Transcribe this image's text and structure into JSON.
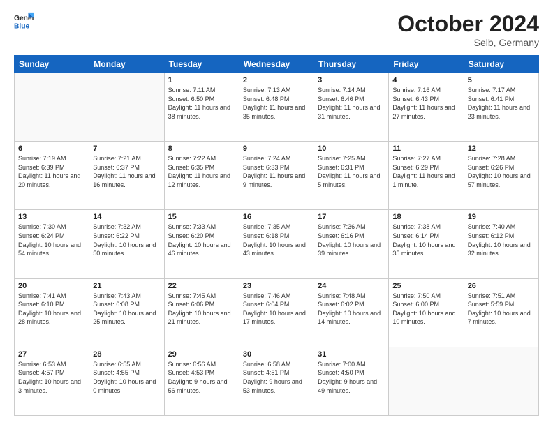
{
  "header": {
    "logo_general": "General",
    "logo_blue": "Blue",
    "month_title": "October 2024",
    "location": "Selb, Germany"
  },
  "weekdays": [
    "Sunday",
    "Monday",
    "Tuesday",
    "Wednesday",
    "Thursday",
    "Friday",
    "Saturday"
  ],
  "weeks": [
    [
      {
        "day": "",
        "info": ""
      },
      {
        "day": "",
        "info": ""
      },
      {
        "day": "1",
        "info": "Sunrise: 7:11 AM\nSunset: 6:50 PM\nDaylight: 11 hours and 38 minutes."
      },
      {
        "day": "2",
        "info": "Sunrise: 7:13 AM\nSunset: 6:48 PM\nDaylight: 11 hours and 35 minutes."
      },
      {
        "day": "3",
        "info": "Sunrise: 7:14 AM\nSunset: 6:46 PM\nDaylight: 11 hours and 31 minutes."
      },
      {
        "day": "4",
        "info": "Sunrise: 7:16 AM\nSunset: 6:43 PM\nDaylight: 11 hours and 27 minutes."
      },
      {
        "day": "5",
        "info": "Sunrise: 7:17 AM\nSunset: 6:41 PM\nDaylight: 11 hours and 23 minutes."
      }
    ],
    [
      {
        "day": "6",
        "info": "Sunrise: 7:19 AM\nSunset: 6:39 PM\nDaylight: 11 hours and 20 minutes."
      },
      {
        "day": "7",
        "info": "Sunrise: 7:21 AM\nSunset: 6:37 PM\nDaylight: 11 hours and 16 minutes."
      },
      {
        "day": "8",
        "info": "Sunrise: 7:22 AM\nSunset: 6:35 PM\nDaylight: 11 hours and 12 minutes."
      },
      {
        "day": "9",
        "info": "Sunrise: 7:24 AM\nSunset: 6:33 PM\nDaylight: 11 hours and 9 minutes."
      },
      {
        "day": "10",
        "info": "Sunrise: 7:25 AM\nSunset: 6:31 PM\nDaylight: 11 hours and 5 minutes."
      },
      {
        "day": "11",
        "info": "Sunrise: 7:27 AM\nSunset: 6:29 PM\nDaylight: 11 hours and 1 minute."
      },
      {
        "day": "12",
        "info": "Sunrise: 7:28 AM\nSunset: 6:26 PM\nDaylight: 10 hours and 57 minutes."
      }
    ],
    [
      {
        "day": "13",
        "info": "Sunrise: 7:30 AM\nSunset: 6:24 PM\nDaylight: 10 hours and 54 minutes."
      },
      {
        "day": "14",
        "info": "Sunrise: 7:32 AM\nSunset: 6:22 PM\nDaylight: 10 hours and 50 minutes."
      },
      {
        "day": "15",
        "info": "Sunrise: 7:33 AM\nSunset: 6:20 PM\nDaylight: 10 hours and 46 minutes."
      },
      {
        "day": "16",
        "info": "Sunrise: 7:35 AM\nSunset: 6:18 PM\nDaylight: 10 hours and 43 minutes."
      },
      {
        "day": "17",
        "info": "Sunrise: 7:36 AM\nSunset: 6:16 PM\nDaylight: 10 hours and 39 minutes."
      },
      {
        "day": "18",
        "info": "Sunrise: 7:38 AM\nSunset: 6:14 PM\nDaylight: 10 hours and 35 minutes."
      },
      {
        "day": "19",
        "info": "Sunrise: 7:40 AM\nSunset: 6:12 PM\nDaylight: 10 hours and 32 minutes."
      }
    ],
    [
      {
        "day": "20",
        "info": "Sunrise: 7:41 AM\nSunset: 6:10 PM\nDaylight: 10 hours and 28 minutes."
      },
      {
        "day": "21",
        "info": "Sunrise: 7:43 AM\nSunset: 6:08 PM\nDaylight: 10 hours and 25 minutes."
      },
      {
        "day": "22",
        "info": "Sunrise: 7:45 AM\nSunset: 6:06 PM\nDaylight: 10 hours and 21 minutes."
      },
      {
        "day": "23",
        "info": "Sunrise: 7:46 AM\nSunset: 6:04 PM\nDaylight: 10 hours and 17 minutes."
      },
      {
        "day": "24",
        "info": "Sunrise: 7:48 AM\nSunset: 6:02 PM\nDaylight: 10 hours and 14 minutes."
      },
      {
        "day": "25",
        "info": "Sunrise: 7:50 AM\nSunset: 6:00 PM\nDaylight: 10 hours and 10 minutes."
      },
      {
        "day": "26",
        "info": "Sunrise: 7:51 AM\nSunset: 5:59 PM\nDaylight: 10 hours and 7 minutes."
      }
    ],
    [
      {
        "day": "27",
        "info": "Sunrise: 6:53 AM\nSunset: 4:57 PM\nDaylight: 10 hours and 3 minutes."
      },
      {
        "day": "28",
        "info": "Sunrise: 6:55 AM\nSunset: 4:55 PM\nDaylight: 10 hours and 0 minutes."
      },
      {
        "day": "29",
        "info": "Sunrise: 6:56 AM\nSunset: 4:53 PM\nDaylight: 9 hours and 56 minutes."
      },
      {
        "day": "30",
        "info": "Sunrise: 6:58 AM\nSunset: 4:51 PM\nDaylight: 9 hours and 53 minutes."
      },
      {
        "day": "31",
        "info": "Sunrise: 7:00 AM\nSunset: 4:50 PM\nDaylight: 9 hours and 49 minutes."
      },
      {
        "day": "",
        "info": ""
      },
      {
        "day": "",
        "info": ""
      }
    ]
  ]
}
